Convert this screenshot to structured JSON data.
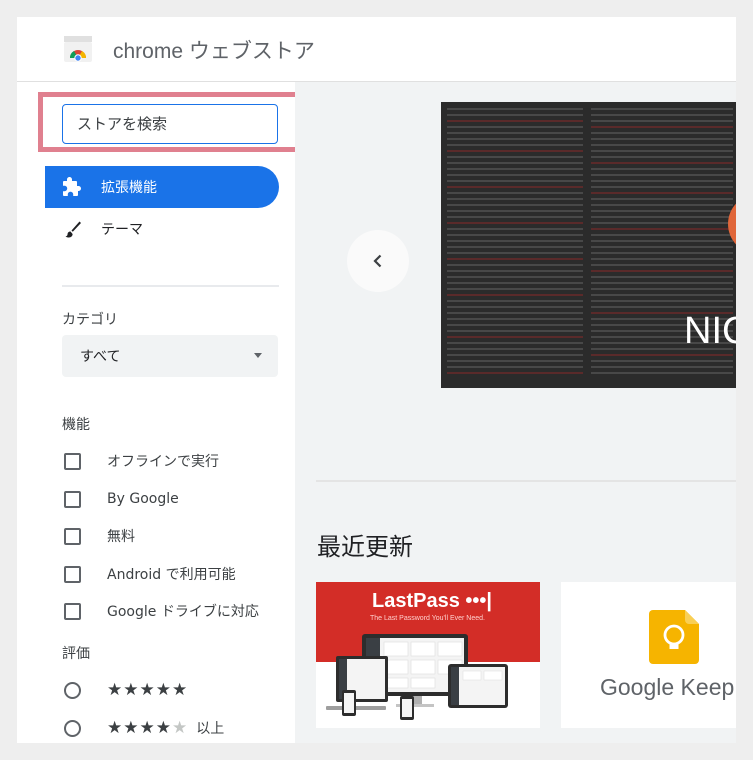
{
  "header": {
    "app_title": "chrome ウェブストア",
    "logo_icon": "chrome-web-store-icon"
  },
  "sidebar": {
    "search": {
      "placeholder": "ストアを検索",
      "highlight_color": "#e0808f"
    },
    "nav": [
      {
        "label": "拡張機能",
        "icon": "puzzle-icon",
        "active": true
      },
      {
        "label": "テーマ",
        "icon": "brush-icon",
        "active": false
      }
    ],
    "category": {
      "heading": "カテゴリ",
      "selected": "すべて"
    },
    "features": {
      "heading": "機能",
      "items": [
        "オフラインで実行",
        "By Google",
        "無料",
        "Android で利用可能",
        "Google ドライブに対応"
      ]
    },
    "ratings": {
      "heading": "評価",
      "items": [
        {
          "stars": 5,
          "label": ""
        },
        {
          "stars": 4,
          "label": "以上"
        }
      ]
    }
  },
  "main": {
    "banner_label": "NIC",
    "section_title": "最近更新",
    "cards": [
      {
        "name": "lastpass",
        "logo": "LastPass •••|",
        "tagline": "The Last Password You'll Ever Need."
      },
      {
        "name": "google-keep",
        "label": "Google Keep"
      }
    ]
  },
  "colors": {
    "accent": "#1a73e8",
    "lastpass_red": "#d32d27",
    "keep_yellow": "#f6b400"
  }
}
